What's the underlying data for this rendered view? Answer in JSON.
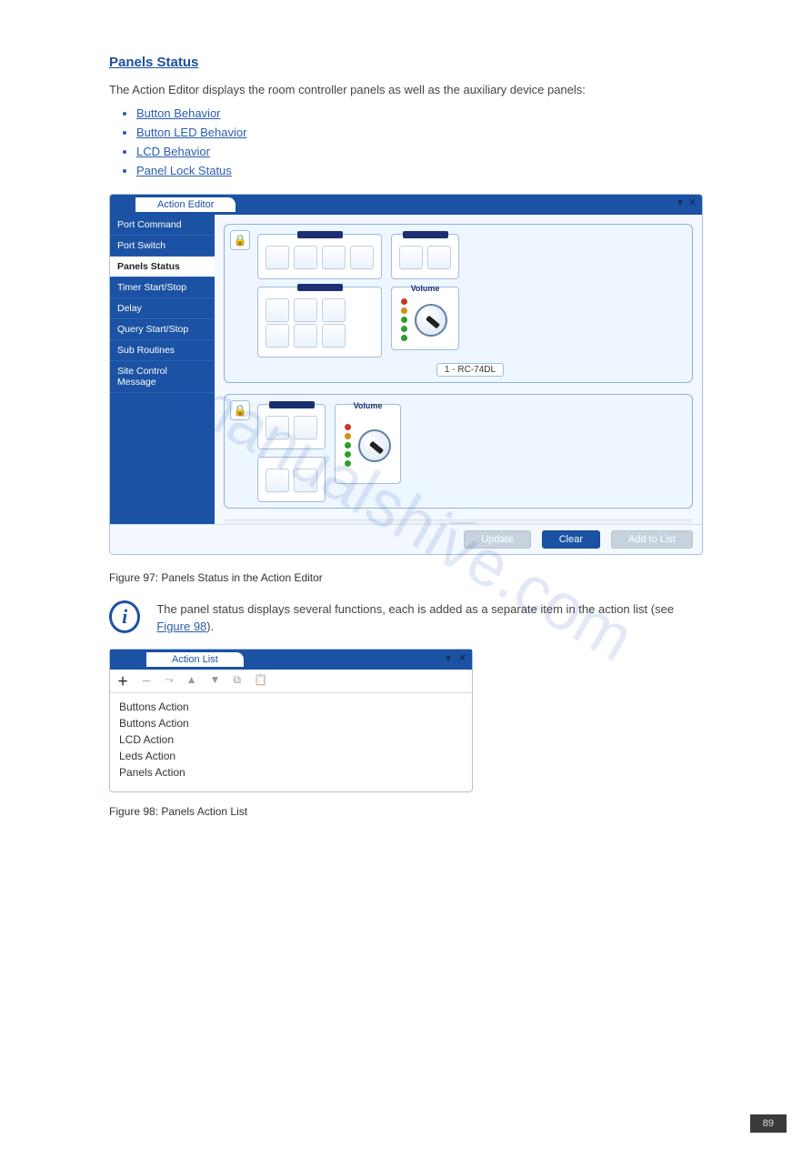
{
  "watermark": "manualshive.com",
  "heading": "Panels Status",
  "intro": "The Action Editor displays the room controller panels as well as the auxiliary device panels:",
  "links": [
    "Button Behavior",
    "Button LED Behavior",
    "LCD Behavior",
    "Panel Lock Status"
  ],
  "action_editor": {
    "title": "Action Editor",
    "sidebar": [
      "Port Command",
      "Port Switch",
      "Panels Status",
      "Timer Start/Stop",
      "Delay",
      "Query Start/Stop",
      "Sub Routines",
      "Site Control Message"
    ],
    "active_index": 2,
    "device1": {
      "volume_label": "Volume",
      "caption": "1 - RC-74DL"
    },
    "device2": {
      "volume_label": "Volume"
    },
    "buttons": {
      "update": "Update",
      "clear": "Clear",
      "add": "Add to List"
    }
  },
  "figure_caption": "Figure 97: Panels Status in the Action Editor",
  "info_note": "The panel status displays several functions, each is added as a separate item in the action list (see",
  "info_link": "Figure 98",
  "info_tail": ").",
  "action_list": {
    "title": "Action List",
    "items": [
      "Buttons Action",
      "Buttons Action",
      "LCD Action",
      "Leds Action",
      "Panels Action"
    ]
  },
  "fig2_caption": "Figure 98: Panels Action List",
  "page_no": "89"
}
